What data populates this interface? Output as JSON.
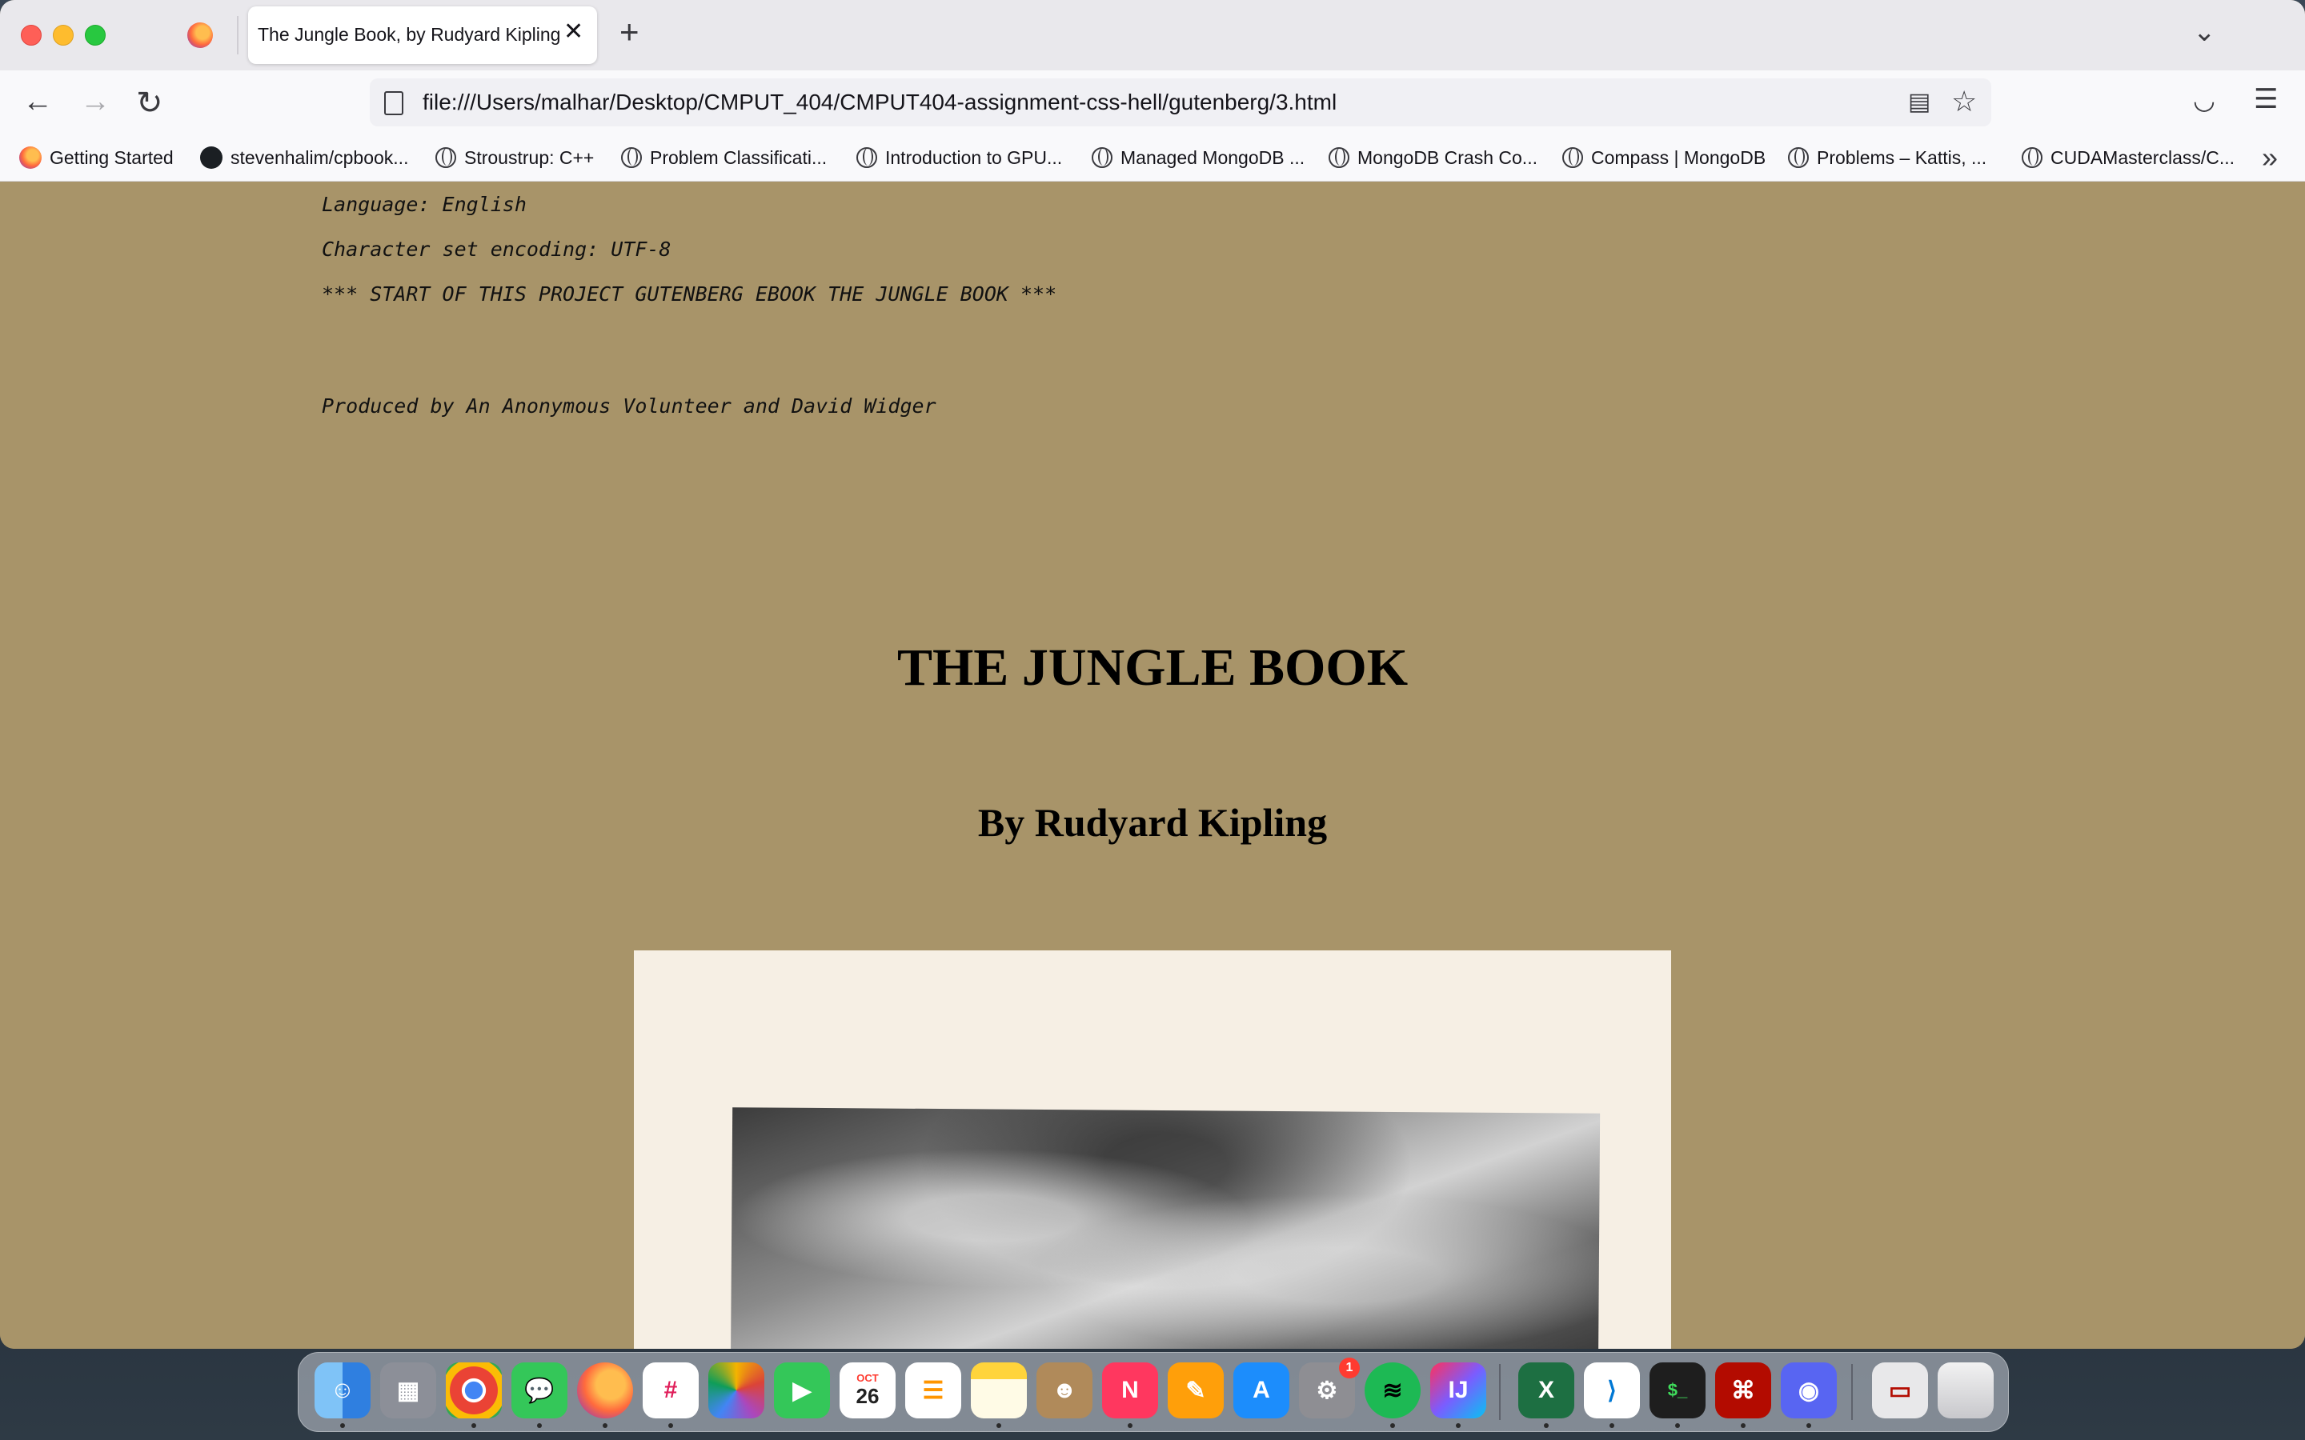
{
  "browser": {
    "tab_title": "The Jungle Book, by Rudyard Kipling",
    "url": "file:///Users/malhar/Desktop/CMPUT_404/CMPUT404-assignment-css-hell/gutenberg/3.html",
    "icons": {
      "back": "back-arrow-icon",
      "forward": "forward-arrow-icon",
      "reload": "reload-icon",
      "reader": "reader-view-icon",
      "bookmark": "star-icon",
      "pocket": "pocket-icon",
      "menu": "hamburger-menu-icon",
      "tab_list": "chevron-down-icon",
      "new_tab": "plus-icon",
      "close_tab": "close-icon"
    }
  },
  "bookmarks": [
    {
      "label": "Getting Started",
      "icon": "firefox-icon"
    },
    {
      "label": "stevenhalim/cpbook...",
      "icon": "github-icon"
    },
    {
      "label": "Stroustrup: C++",
      "icon": "globe-icon"
    },
    {
      "label": "Problem Classificati...",
      "icon": "globe-icon"
    },
    {
      "label": "Introduction to GPU...",
      "icon": "globe-icon"
    },
    {
      "label": "Managed MongoDB ...",
      "icon": "globe-icon"
    },
    {
      "label": "MongoDB Crash Co...",
      "icon": "globe-icon"
    },
    {
      "label": "Compass | MongoDB",
      "icon": "globe-icon"
    },
    {
      "label": "Problems – Kattis, ...",
      "icon": "globe-icon"
    },
    {
      "label": "CUDAMasterclass/C...",
      "icon": "globe-icon"
    }
  ],
  "page": {
    "language": "Language: English",
    "encoding": "Character set encoding: UTF-8",
    "start_marker": "*** START OF THIS PROJECT GUTENBERG EBOOK THE JUNGLE BOOK ***",
    "producer": "Produced by An Anonymous Volunteer and David Widger",
    "title": "THE JUNGLE BOOK",
    "author": "By Rudyard Kipling"
  },
  "dock": {
    "calendar_month": "OCT",
    "calendar_day": "26",
    "settings_badge": "1",
    "apps": [
      "Finder",
      "Launchpad",
      "Chrome",
      "Messages",
      "Firefox",
      "Slack",
      "Photos",
      "FaceTime",
      "Calendar",
      "Reminders",
      "Notes",
      "Contacts",
      "News",
      "Pages",
      "App Store",
      "System Preferences",
      "Spotify",
      "IntelliJ IDEA",
      "Excel",
      "VS Code",
      "Terminal",
      "Acrobat",
      "Discord",
      "Preview",
      "Trash"
    ]
  },
  "colors": {
    "page_background": "#a89469",
    "tab_strip": "#e9e8ec",
    "toolbar": "#f9f9fb"
  }
}
